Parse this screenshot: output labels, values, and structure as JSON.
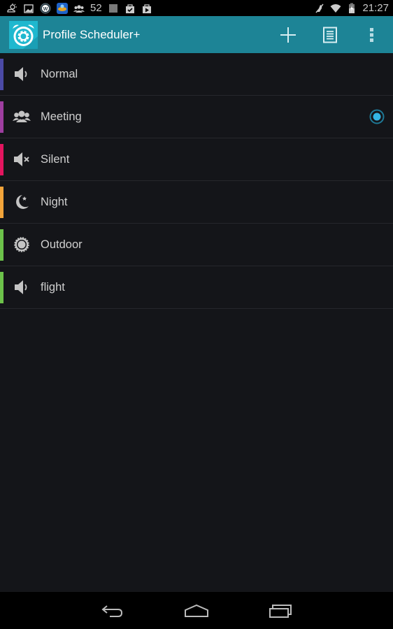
{
  "status_bar": {
    "left_icons": [
      "weather-icon",
      "image-icon",
      "wordpress-icon",
      "game-app-icon",
      "group-icon"
    ],
    "notification_count": "52",
    "right_icons": [
      "barcode-icon",
      "shopping-bag-check-icon",
      "play-store-icon",
      "mute-icon",
      "wifi-icon",
      "battery-charging-icon"
    ],
    "time": "21:27"
  },
  "action_bar": {
    "title": "Profile Scheduler+",
    "actions": [
      {
        "name": "add",
        "icon": "plus-icon"
      },
      {
        "name": "log",
        "icon": "document-icon"
      },
      {
        "name": "overflow",
        "icon": "more-vertical-icon"
      }
    ]
  },
  "profiles": [
    {
      "label": "Normal",
      "icon": "speaker-icon",
      "color": "#4b4aa6",
      "active": false
    },
    {
      "label": "Meeting",
      "icon": "group-icon",
      "color": "#9e3ea0",
      "active": true
    },
    {
      "label": "Silent",
      "icon": "speaker-mute-icon",
      "color": "#e3155f",
      "active": false
    },
    {
      "label": "Night",
      "icon": "moon-star-icon",
      "color": "#f2a43a",
      "active": false
    },
    {
      "label": "Outdoor",
      "icon": "sun-icon",
      "color": "#6cc24a",
      "active": false
    },
    {
      "label": "flight",
      "icon": "speaker-icon",
      "color": "#6cc24a",
      "active": false
    }
  ],
  "colors": {
    "action_bar": "#1d8496",
    "background": "#141519",
    "radio_active": "#33b5e5"
  },
  "nav_bar": {
    "buttons": [
      "back",
      "home",
      "recents"
    ]
  }
}
